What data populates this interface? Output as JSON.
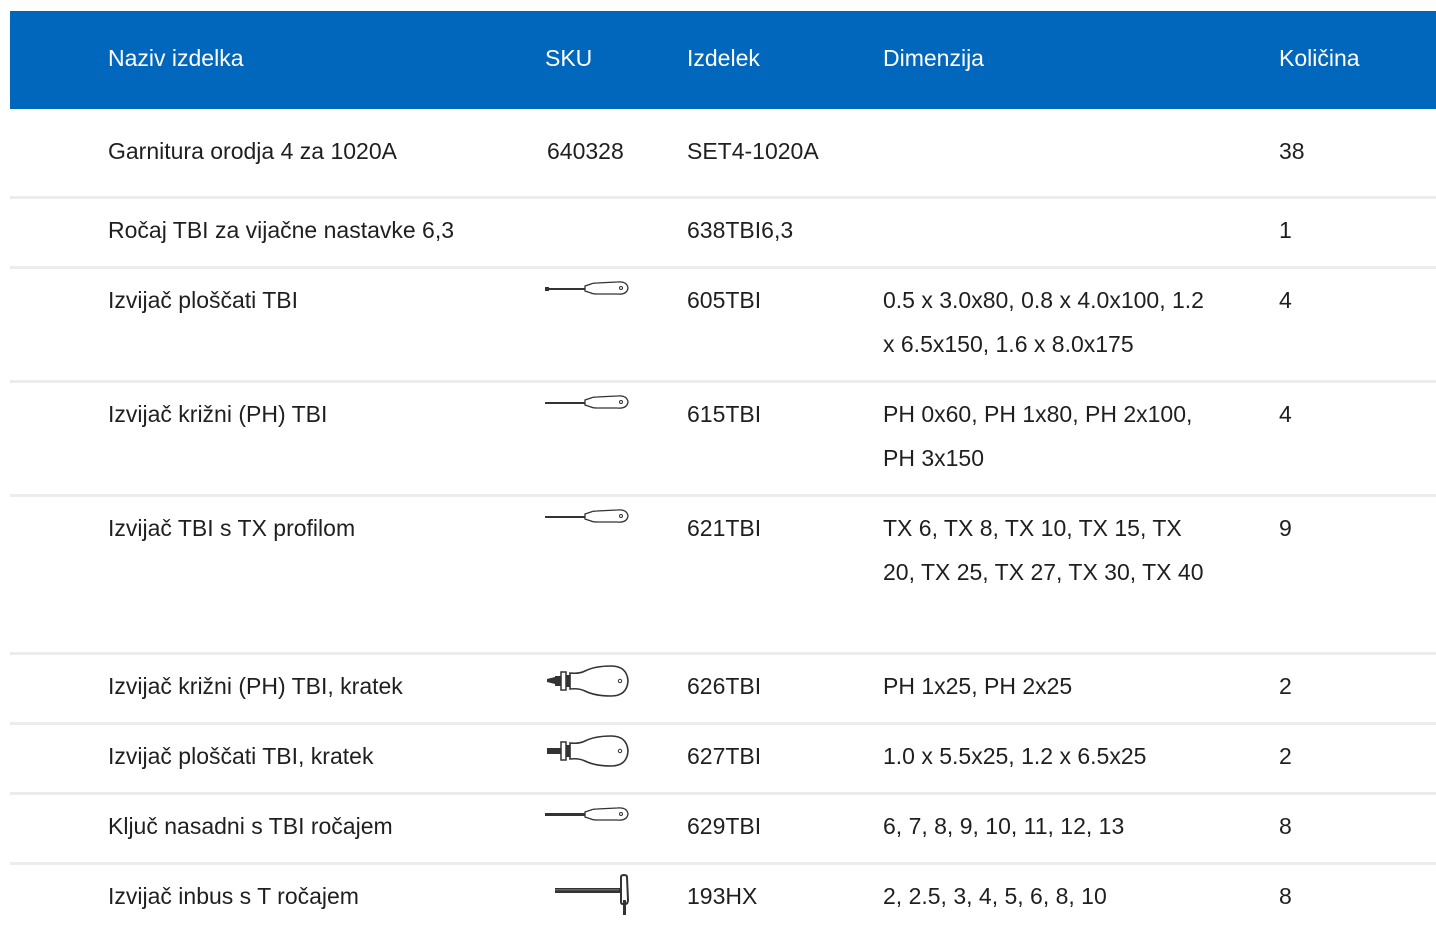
{
  "table": {
    "headers": {
      "name": "Naziv izdelka",
      "sku": "SKU",
      "product": "Izdelek",
      "dimension": "Dimenzija",
      "quantity": "Količina"
    },
    "rows": [
      {
        "name": "Garnitura orodja 4 za 1020A",
        "sku": "640328",
        "sku_icon": "",
        "product": "SET4-1020A",
        "dimension": "",
        "quantity": "38"
      },
      {
        "name": "Ročaj TBI za vijačne nastavke 6,3",
        "sku": "",
        "sku_icon": "",
        "product": "638TBI6,3",
        "dimension": "",
        "quantity": "1"
      },
      {
        "name": "Izvijač ploščati TBI",
        "sku": "",
        "sku_icon": "long-screwdriver-icon",
        "product": "605TBI",
        "dimension": "0.5 x 3.0x80, 0.8 x 4.0x100, 1.2 x 6.5x150, 1.6 x 8.0x175",
        "quantity": "4"
      },
      {
        "name": "Izvijač križni (PH) TBI",
        "sku": "",
        "sku_icon": "long-screwdriver-icon",
        "product": "615TBI",
        "dimension": "PH 0x60, PH 1x80, PH 2x100, PH 3x150",
        "quantity": "4"
      },
      {
        "name": "Izvijač TBI s TX profilom",
        "sku": "",
        "sku_icon": "long-screwdriver-icon",
        "product": "621TBI",
        "dimension": "TX 6, TX 8, TX 10, TX 15, TX 20, TX 25, TX 27, TX 30, TX 40",
        "quantity": "9"
      },
      {
        "name": "Izvijač križni (PH) TBI, kratek",
        "sku": "",
        "sku_icon": "stubby-phillips-screwdriver-icon",
        "product": "626TBI",
        "dimension": "PH 1x25, PH 2x25",
        "quantity": "2"
      },
      {
        "name": "Izvijač ploščati TBI, kratek",
        "sku": "",
        "sku_icon": "stubby-flat-screwdriver-icon",
        "product": "627TBI",
        "dimension": "1.0 x 5.5x25, 1.2 x 6.5x25",
        "quantity": "2"
      },
      {
        "name": "Ključ nasadni s TBI ročajem",
        "sku": "",
        "sku_icon": "long-screwdriver-icon",
        "product": "629TBI",
        "dimension": "6, 7, 8, 9, 10, 11, 12, 13",
        "quantity": "8"
      },
      {
        "name": "Izvijač inbus s T ročajem",
        "sku": "",
        "sku_icon": "t-handle-hex-key-icon",
        "product": "193HX",
        "dimension": "2, 2.5, 3, 4, 5, 6, 8, 10",
        "quantity": "8"
      }
    ]
  },
  "colors": {
    "header_bg": "#0067bc",
    "header_text": "#ffffff",
    "row_divider": "#ececec",
    "text": "#1f1f1f"
  }
}
